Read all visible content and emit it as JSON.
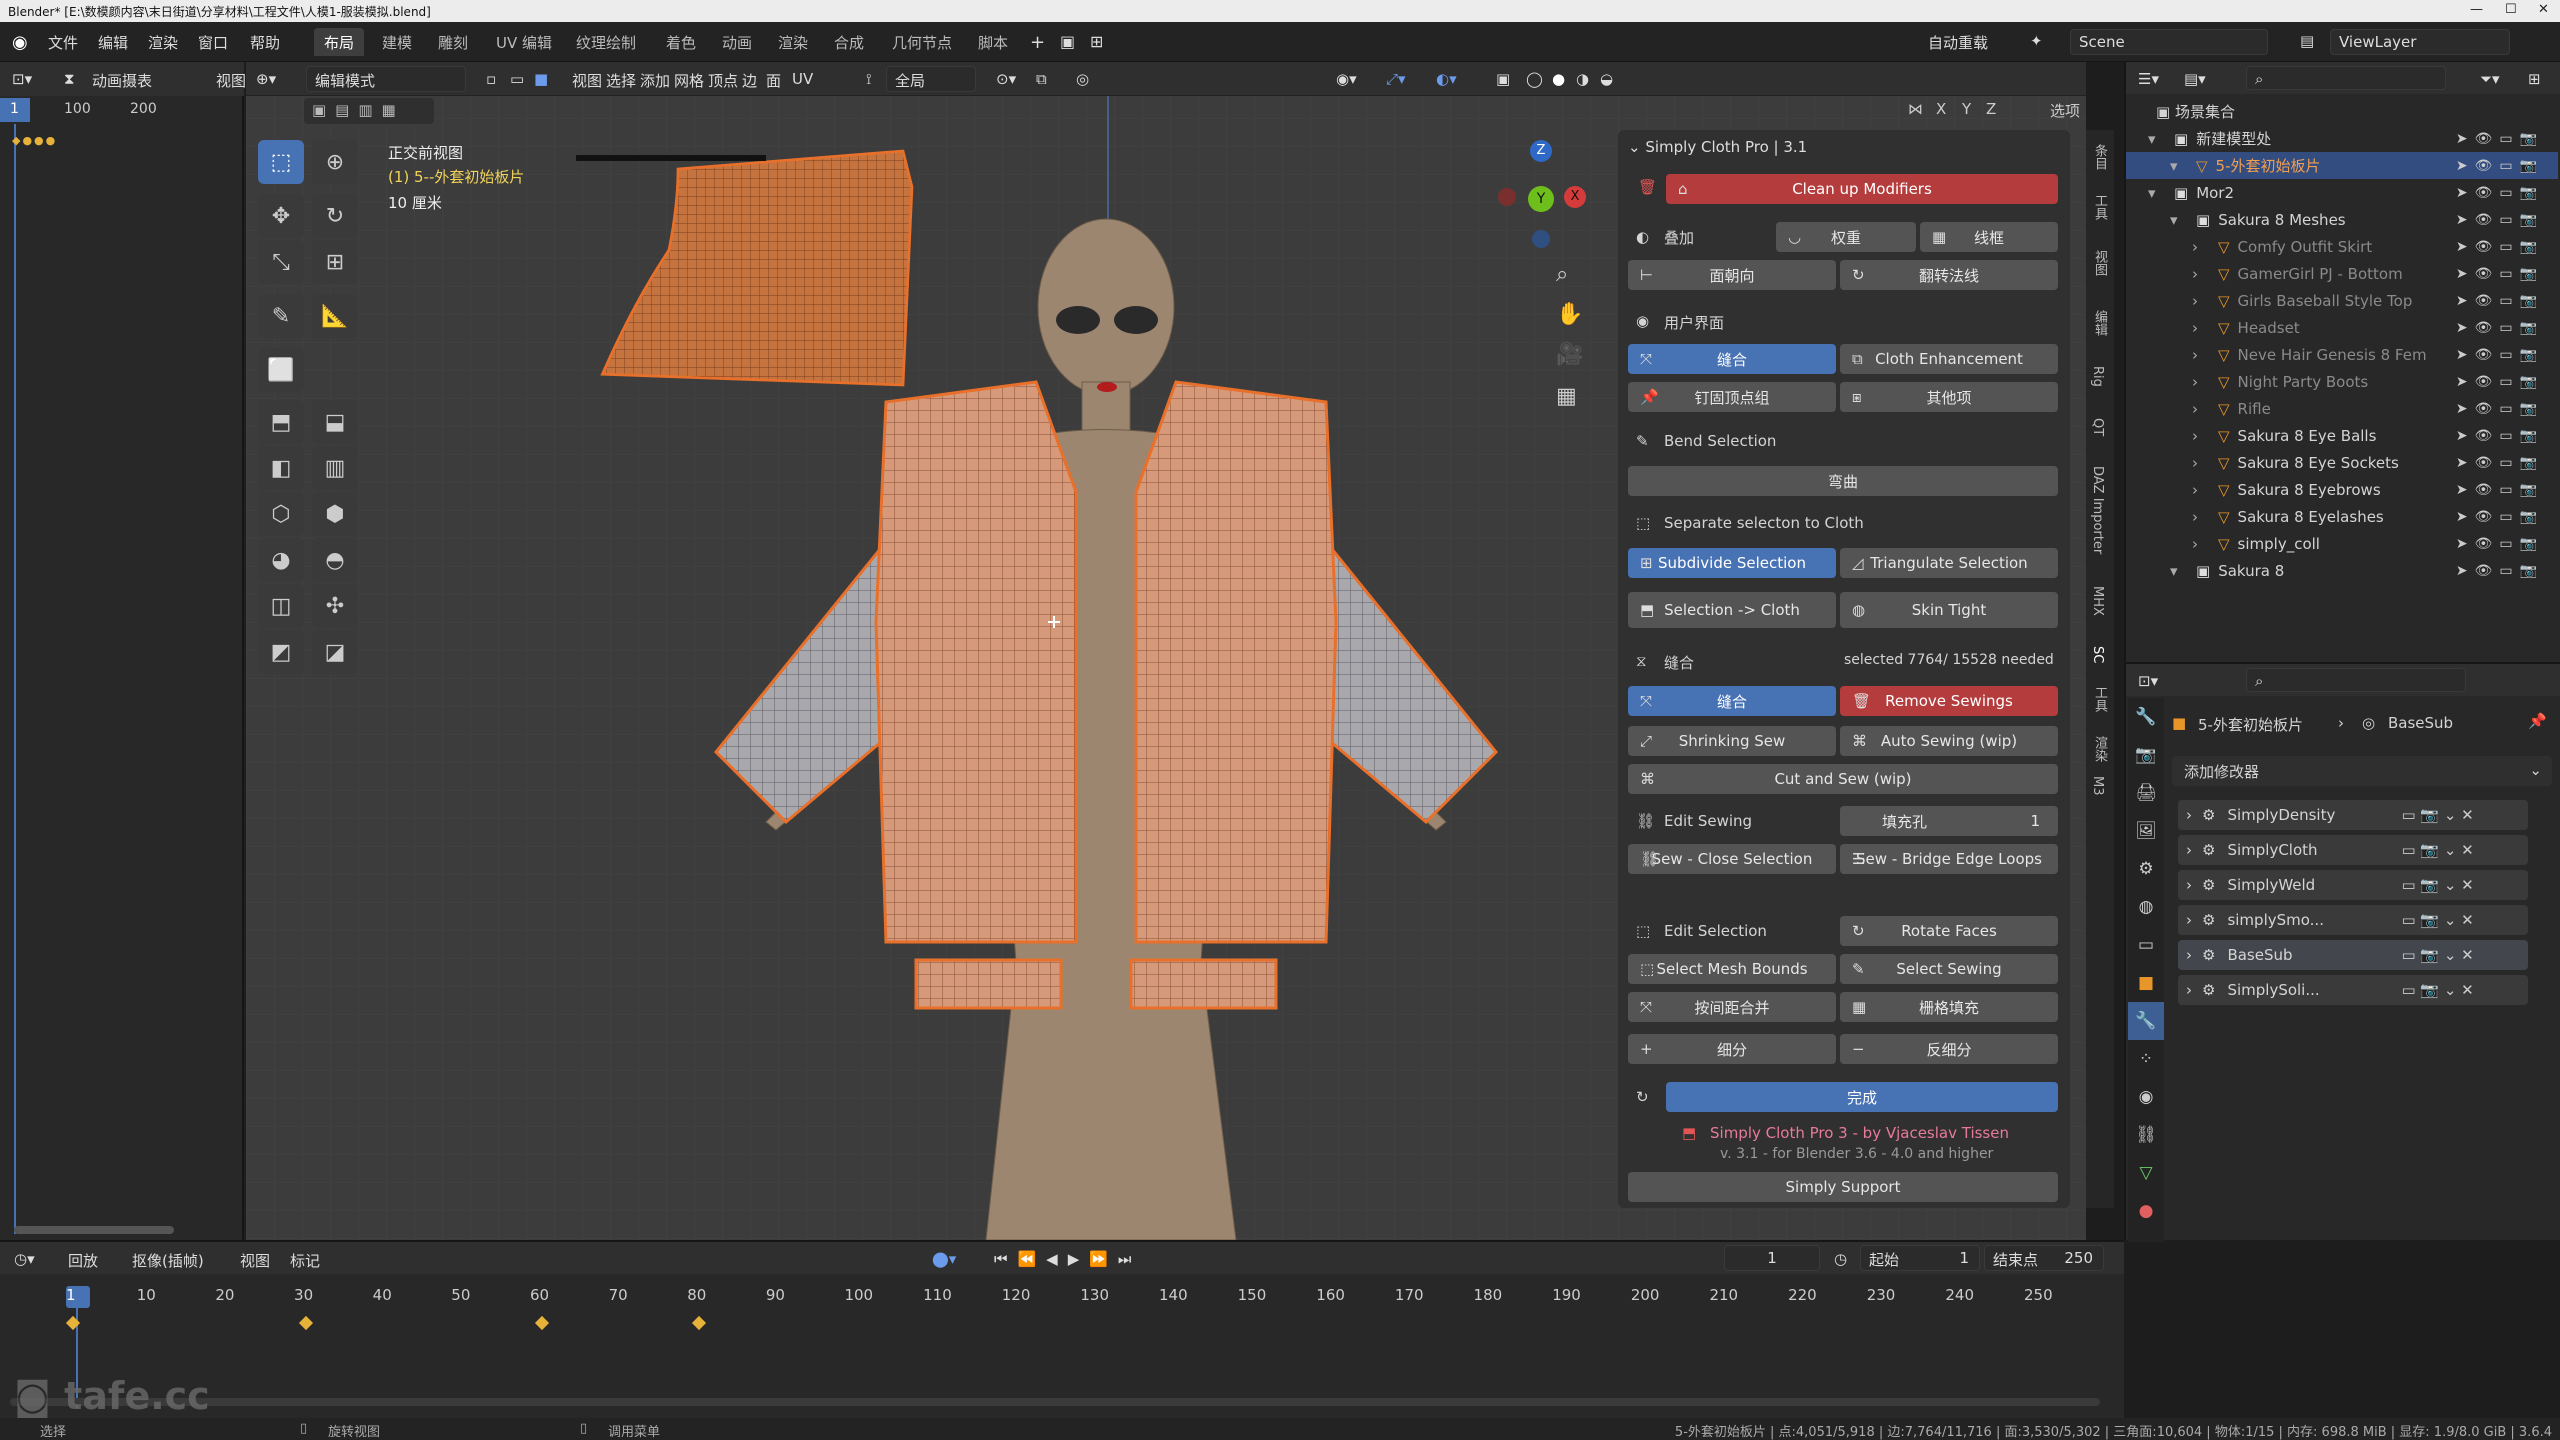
{
  "window": {
    "title": "Blender* [E:\\数模颜内容\\末日街道\\分享材料\\工程文件\\人模1-服装模拟.blend]"
  },
  "topbar": {
    "menus": [
      "文件",
      "编辑",
      "渲染",
      "窗口",
      "帮助"
    ],
    "workspaces": [
      "布局",
      "建模",
      "雕刻",
      "UV 编辑",
      "纹理绘制",
      "着色",
      "动画",
      "渲染",
      "合成",
      "几何节点",
      "脚本"
    ],
    "active_workspace": "布局",
    "autosave": "自动重载",
    "scene": "Scene",
    "viewlayer": "ViewLayer"
  },
  "left": {
    "editor": "动画摄表",
    "view": "视图",
    "frames": [
      "1",
      "100",
      "200"
    ]
  },
  "viewport": {
    "mode": "编辑模式",
    "menus": [
      "视图",
      "选择",
      "添加",
      "网格",
      "顶点",
      "边",
      "面",
      "UV"
    ],
    "transform": "全局",
    "options": "选项",
    "axis": [
      "X",
      "Y",
      "Z"
    ],
    "overlay": {
      "view_name": "正交前视图",
      "object": "(1) 5--外套初始板片",
      "scale": "10 厘米"
    },
    "gizmo": {
      "z": "Z",
      "y": "Y",
      "x": "X"
    }
  },
  "npanel": {
    "title": "Simply Cloth Pro | 3.1",
    "cleanup": "Clean up Modifiers",
    "overlay_label": "叠加",
    "weight": "权重",
    "wire": "线框",
    "face_orient": "面朝向",
    "flip_normal": "翻转法线",
    "ui_label": "用户界面",
    "sew_tab": "缝合",
    "cloth_enh": "Cloth Enhancement",
    "pin_group": "钉固顶点组",
    "other": "其他项",
    "bend_sel": "Bend Selection",
    "bend": "弯曲",
    "sep_cloth": "Separate selecton to Cloth",
    "subdiv_sel": "Subdivide Selection",
    "tri_sel": "Triangulate Selection",
    "sel_cloth": "Selection -> Cloth",
    "skin_tight": "Skin Tight",
    "sew_label": "缝合",
    "sew_count": "selected 7764/ 15528 needed",
    "sew_btn": "缝合",
    "remove_sew": "Remove Sewings",
    "shrink_sew": "Shrinking Sew",
    "auto_sew": "Auto Sewing (wip)",
    "cut_sew": "Cut and Sew (wip)",
    "edit_sewing": "Edit Sewing",
    "fill_hole": "填充孔",
    "fill_val": "1",
    "close_sel": "Sew - Close Selection",
    "bridge": "Sew - Bridge Edge Loops",
    "edit_sel": "Edit Selection",
    "rotate_faces": "Rotate Faces",
    "mesh_bounds": "Select Mesh Bounds",
    "select_sewing": "Select Sewing",
    "merge_dist": "按间距合并",
    "grid_fill": "栅格填充",
    "subdiv": "细分",
    "unsubdiv": "反细分",
    "done": "完成",
    "credit": "Simply Cloth Pro 3 - by Vjaceslav Tissen",
    "version": "v. 3.1 - for Blender 3.6 - 4.0 and higher",
    "support": "Simply Support",
    "side_tabs": [
      "条目",
      "工具",
      "视图",
      "编辑",
      "Rig",
      "QT",
      "DAZ Importer",
      "MHX",
      "SC",
      "工具",
      "渲染",
      "M3"
    ]
  },
  "outliner": {
    "search": "",
    "root": "场景集合",
    "rows": [
      {
        "name": "新建模型处",
        "indent": 1
      },
      {
        "name": "5-外套初始板片",
        "indent": 2,
        "selected": true
      },
      {
        "name": "Mor2",
        "indent": 1
      },
      {
        "name": "Sakura 8 Meshes",
        "indent": 2
      },
      {
        "name": "Comfy Outfit Skirt",
        "indent": 3,
        "dim": true
      },
      {
        "name": "GamerGirl PJ - Bottom",
        "indent": 3,
        "dim": true
      },
      {
        "name": "Girls Baseball Style Top",
        "indent": 3,
        "dim": true
      },
      {
        "name": "Headset",
        "indent": 3,
        "dim": true
      },
      {
        "name": "Neve Hair Genesis 8 Fem",
        "indent": 3,
        "dim": true
      },
      {
        "name": "Night Party Boots",
        "indent": 3,
        "dim": true
      },
      {
        "name": "Rifle",
        "indent": 3,
        "dim": true
      },
      {
        "name": "Sakura 8 Eye Balls",
        "indent": 3
      },
      {
        "name": "Sakura 8 Eye Sockets",
        "indent": 3
      },
      {
        "name": "Sakura 8 Eyebrows",
        "indent": 3
      },
      {
        "name": "Sakura 8 Eyelashes",
        "indent": 3
      },
      {
        "name": "simply_coll",
        "indent": 3
      },
      {
        "name": "Sakura 8",
        "indent": 2
      }
    ]
  },
  "properties": {
    "breadcrumb_obj": "5-外套初始板片",
    "breadcrumb_mod": "BaseSub",
    "add_modifier": "添加修改器",
    "modifiers": [
      "SimplyDensity",
      "SimplyCloth",
      "SimplyWeld",
      "simplySmo...",
      "BaseSub",
      "SimplySoli..."
    ]
  },
  "timeline": {
    "menus": [
      "回放",
      "抠像(插帧)",
      "视图",
      "标记"
    ],
    "current": "1",
    "start_label": "起始",
    "start": "1",
    "end_label": "结束点",
    "end": "250",
    "ticks": [
      "1",
      "10",
      "20",
      "30",
      "40",
      "50",
      "60",
      "70",
      "80",
      "90",
      "100",
      "110",
      "120",
      "130",
      "140",
      "150",
      "160",
      "170",
      "180",
      "190",
      "200",
      "210",
      "220",
      "230",
      "240",
      "250"
    ]
  },
  "status": {
    "left1": "选择",
    "left2": "旋转视图",
    "left3": "调用菜单",
    "right": "5-外套初始板片 | 点:4,051/5,918 | 边:7,764/11,716 | 面:3,530/5,302 | 三角面:10,604 | 物体:1/15 | 内存: 698.8 MiB | 显存: 1.9/8.0 GiB | 3.6.4"
  },
  "watermark": "tafe.cc",
  "colors": {
    "accent": "#4772b3",
    "danger": "#b43c3c",
    "selection": "#e8702a",
    "cloth": "#d99a78"
  }
}
